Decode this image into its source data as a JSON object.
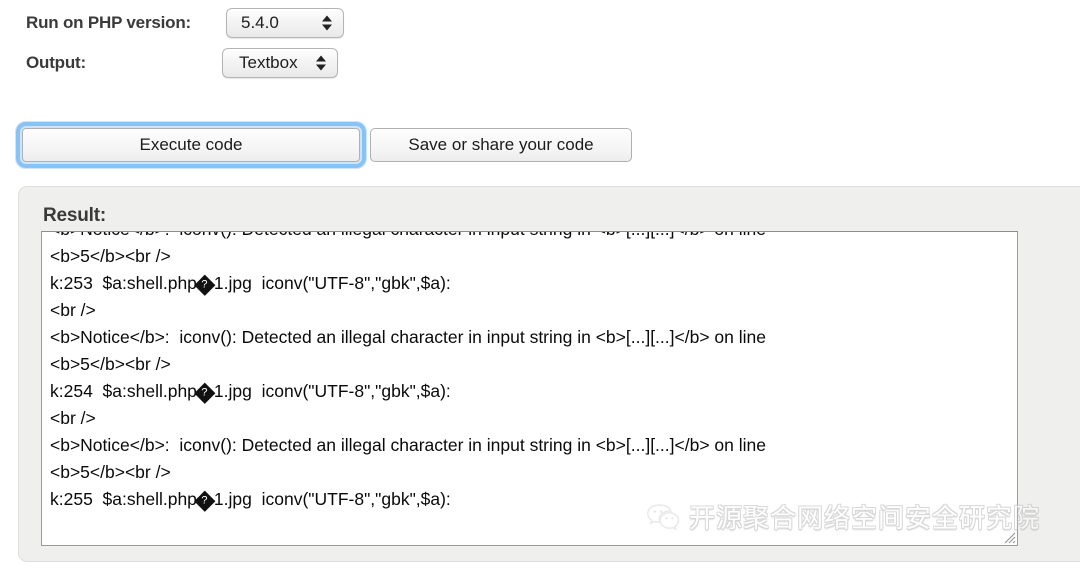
{
  "form": {
    "php_version": {
      "label": "Run on PHP version:",
      "value": "5.4.0",
      "options": [
        "5.4.0"
      ],
      "stepper_icon": "stepper-updown-icon"
    },
    "output": {
      "label": "Output:",
      "value": "Textbox",
      "options": [
        "Textbox"
      ],
      "stepper_icon": "stepper-updown-icon"
    }
  },
  "actions": {
    "execute_label": "Execute code",
    "save_label": "Save or share your code",
    "focused": "execute_label",
    "focus_ring_color": "#89c2f5"
  },
  "result": {
    "title": "Result:",
    "panel_background": "#efefee",
    "textarea_background": "#ffffff",
    "resize_handle_icon": "resize-grabber-icon",
    "lines": [
      "<b>Notice</b>:  iconv(): Detected an illegal character in input string in <b>[...][...]</b> on line",
      "<b>5</b><br />",
      "k:253  $a:shell.php�1.jpg  iconv(\"UTF-8\",\"gbk\",$a):",
      "<br />",
      "<b>Notice</b>:  iconv(): Detected an illegal character in input string in <b>[...][...]</b> on line",
      "<b>5</b><br />",
      "k:254  $a:shell.php�1.jpg  iconv(\"UTF-8\",\"gbk\",$a):",
      "<br />",
      "<b>Notice</b>:  iconv(): Detected an illegal character in input string in <b>[...][...]</b> on line",
      "<b>5</b><br />",
      "k:255  $a:shell.php�1.jpg  iconv(\"UTF-8\",\"gbk\",$a):"
    ]
  },
  "watermark": {
    "text": "开源聚合网络空间安全研究院",
    "icon": "wechat-logo-icon"
  }
}
